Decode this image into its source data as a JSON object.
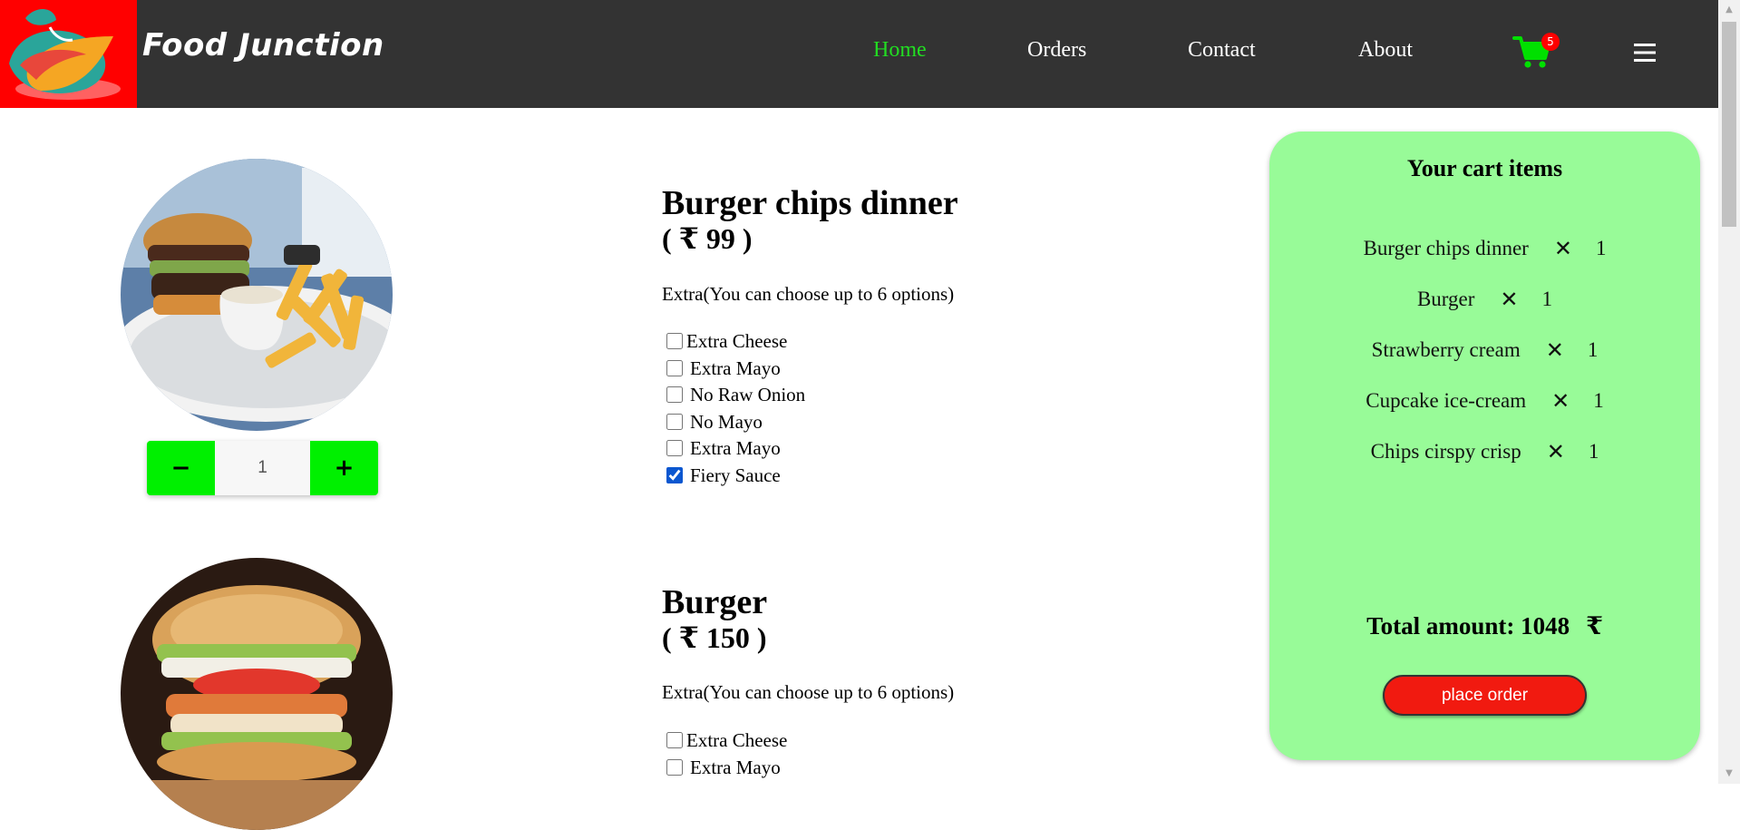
{
  "header": {
    "brand": "Food Junction",
    "nav": [
      {
        "label": "Home",
        "active": true
      },
      {
        "label": "Orders",
        "active": false
      },
      {
        "label": "Contact",
        "active": false
      },
      {
        "label": "About",
        "active": false
      }
    ],
    "cart_count": "5",
    "cart_icon": "shopping-cart-icon",
    "menu_icon": "hamburger-menu-icon"
  },
  "products": [
    {
      "name": "Burger chips dinner",
      "price": "( ₹ 99 )",
      "extra_label": "Extra(You can choose up to 6 options)",
      "quantity": "1",
      "options": [
        {
          "label": "Extra Cheese",
          "checked": false
        },
        {
          "label": "Extra Mayo",
          "checked": false
        },
        {
          "label": "No Raw Onion",
          "checked": false
        },
        {
          "label": "No Mayo",
          "checked": false
        },
        {
          "label": "Extra Mayo",
          "checked": false
        },
        {
          "label": "Fiery Sauce",
          "checked": true
        }
      ]
    },
    {
      "name": "Burger",
      "price": "( ₹ 150 )",
      "extra_label": "Extra(You can choose up to 6 options)",
      "options": [
        {
          "label": "Extra Cheese",
          "checked": false
        },
        {
          "label": "Extra Mayo",
          "checked": false
        }
      ]
    }
  ],
  "stepper": {
    "minus": "−",
    "plus": "+"
  },
  "cart": {
    "title": "Your cart items",
    "items": [
      {
        "name": "Burger chips dinner",
        "remove": "✕",
        "qty": "1"
      },
      {
        "name": "Burger",
        "remove": "✕",
        "qty": "1"
      },
      {
        "name": "Strawberry cream",
        "remove": "✕",
        "qty": "1"
      },
      {
        "name": "Cupcake ice-cream",
        "remove": "✕",
        "qty": "1"
      },
      {
        "name": "Chips cirspy crisp",
        "remove": "✕",
        "qty": "1"
      }
    ],
    "total_label": "Total amount: 1048",
    "currency": "₹",
    "place_order": "place order"
  },
  "colors": {
    "header_bg": "#333333",
    "logo_bg": "#ff0000",
    "nav_active": "#22dd22",
    "cart_icon": "#00e000",
    "stepper_btn": "#00f000",
    "cart_panel": "#98fb98",
    "place_order_bg": "#f11a10"
  }
}
